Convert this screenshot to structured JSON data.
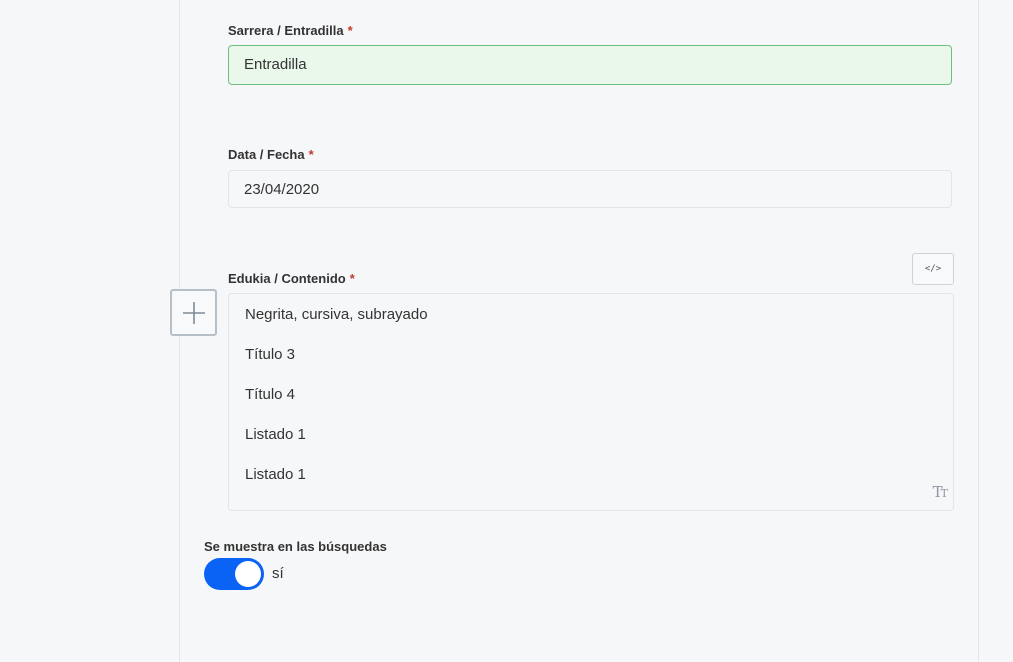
{
  "fields": {
    "entradilla": {
      "label": "Sarrera / Entradilla",
      "required": "*",
      "value": "Entradilla"
    },
    "fecha": {
      "label": "Data / Fecha",
      "required": "*",
      "value": "23/04/2020"
    },
    "contenido": {
      "label": "Edukia / Contenido",
      "required": "*",
      "source_button": "</>",
      "lines": [
        "Negrita, cursiva, subrayado",
        "Título 3",
        "Título 4",
        "Listado 1",
        "Listado 1"
      ]
    },
    "busquedas": {
      "label": "Se muestra en las búsquedas",
      "state_text": "sí",
      "toggle_on": true,
      "toggle_color": "#0a63f5"
    }
  },
  "icons": {
    "add_block": "plus-icon",
    "text_format": "text-size-icon",
    "source": "code-icon"
  },
  "colors": {
    "required_marker": "#c0392b",
    "valid_background": "#eaf8ec",
    "valid_border": "#6cc27d"
  }
}
